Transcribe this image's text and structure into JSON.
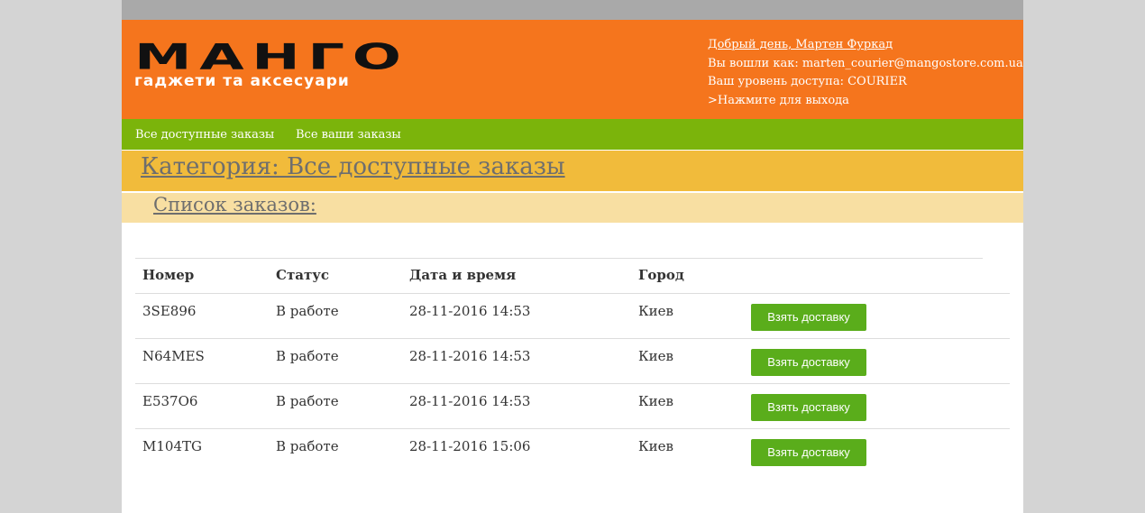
{
  "logo": {
    "main": "МАНГО",
    "sub": "гаджети та аксесуари"
  },
  "user": {
    "greeting": "Добрый день, Мартен Фуркад",
    "logged_as": "Вы вошли как: marten_courier@mangostore.com.ua",
    "access_level": "Ваш уровень доступа: COURIER",
    "logout": ">Нажмите для выхода"
  },
  "nav": {
    "items": [
      {
        "label": "Все доступные заказы"
      },
      {
        "label": "Все ваши заказы"
      }
    ]
  },
  "category_title": "Категория: Все доступные заказы",
  "list_title": "Список заказов:",
  "table": {
    "headers": [
      "Номер",
      "Статус",
      "Дата и время",
      "Город"
    ],
    "rows": [
      {
        "number": "3SE896",
        "status": "В работе",
        "datetime": "28-11-2016 14:53",
        "city": "Киев",
        "action": "Взять доставку"
      },
      {
        "number": "N64MES",
        "status": "В работе",
        "datetime": "28-11-2016 14:53",
        "city": "Киев",
        "action": "Взять доставку"
      },
      {
        "number": "E537O6",
        "status": "В работе",
        "datetime": "28-11-2016 14:53",
        "city": "Киев",
        "action": "Взять доставку"
      },
      {
        "number": "M104TG",
        "status": "В работе",
        "datetime": "28-11-2016 15:06",
        "city": "Киев",
        "action": "Взять доставку"
      }
    ]
  },
  "colors": {
    "header_orange": "#f5751d",
    "nav_green": "#7bb40b",
    "category_yellow": "#f1bb3b",
    "sublist_yellow": "#f8dfa2",
    "button_green": "#5aad1b"
  }
}
